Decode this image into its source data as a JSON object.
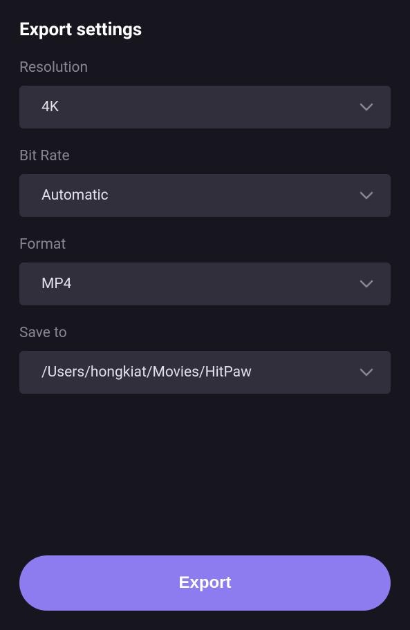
{
  "title": "Export settings",
  "fields": {
    "resolution": {
      "label": "Resolution",
      "value": "4K"
    },
    "bitrate": {
      "label": "Bit Rate",
      "value": "Automatic"
    },
    "format": {
      "label": "Format",
      "value": "MP4"
    },
    "saveto": {
      "label": "Save to",
      "value": "/Users/hongkiat/Movies/HitPaw"
    }
  },
  "export_button_label": "Export"
}
